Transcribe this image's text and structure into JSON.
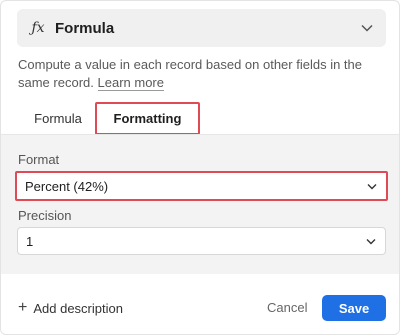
{
  "field_type": {
    "icon": "fx-icon",
    "label": "Formula"
  },
  "description": {
    "text": "Compute a value in each record based on other fields in the same record.",
    "link": "Learn more"
  },
  "tabs": [
    {
      "label": "Formula"
    },
    {
      "label": "Formatting"
    }
  ],
  "format": {
    "label": "Format",
    "value": "Percent (42%)"
  },
  "precision": {
    "label": "Precision",
    "value": "1"
  },
  "footer": {
    "add_description": "Add description",
    "cancel": "Cancel",
    "save": "Save"
  },
  "colors": {
    "highlight": "#e04a54",
    "save_button": "#1f6fe5"
  }
}
